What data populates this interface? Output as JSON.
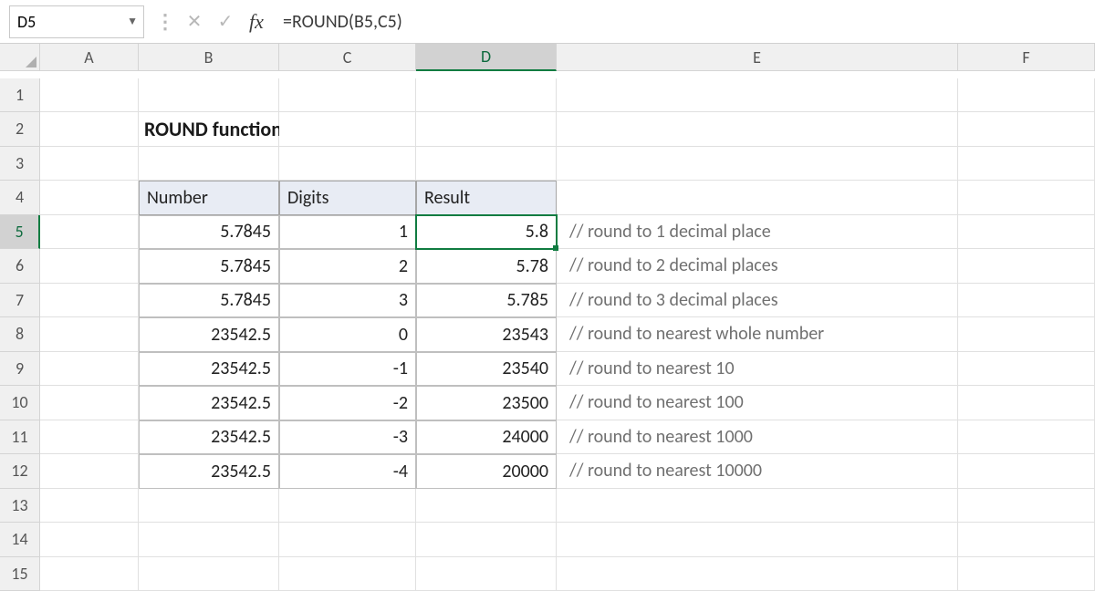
{
  "name_box": "D5",
  "formula_bar": {
    "cancel_label": "✕",
    "accept_label": "✓",
    "fx_label": "fx",
    "formula": "=ROUND(B5,C5)"
  },
  "columns": [
    "A",
    "B",
    "C",
    "D",
    "E",
    "F"
  ],
  "rows_visible": [
    "1",
    "2",
    "3",
    "4",
    "5",
    "6",
    "7",
    "8",
    "9",
    "10",
    "11",
    "12",
    "13",
    "14",
    "15"
  ],
  "selected_cell": "D5",
  "selected_col": "D",
  "selected_row": "5",
  "title": "ROUND function",
  "table": {
    "headers": {
      "b": "Number",
      "c": "Digits",
      "d": "Result"
    },
    "rows": [
      {
        "number": "5.7845",
        "digits": "1",
        "result": "5.8",
        "comment": "// round to 1 decimal place"
      },
      {
        "number": "5.7845",
        "digits": "2",
        "result": "5.78",
        "comment": "// round to 2 decimal places"
      },
      {
        "number": "5.7845",
        "digits": "3",
        "result": "5.785",
        "comment": "// round to 3 decimal places"
      },
      {
        "number": "23542.5",
        "digits": "0",
        "result": "23543",
        "comment": "// round to nearest whole number"
      },
      {
        "number": "23542.5",
        "digits": "-1",
        "result": "23540",
        "comment": "// round to nearest 10"
      },
      {
        "number": "23542.5",
        "digits": "-2",
        "result": "23500",
        "comment": "// round to nearest 100"
      },
      {
        "number": "23542.5",
        "digits": "-3",
        "result": "24000",
        "comment": "// round to nearest 1000"
      },
      {
        "number": "23542.5",
        "digits": "-4",
        "result": "20000",
        "comment": "// round to nearest 10000"
      }
    ]
  }
}
